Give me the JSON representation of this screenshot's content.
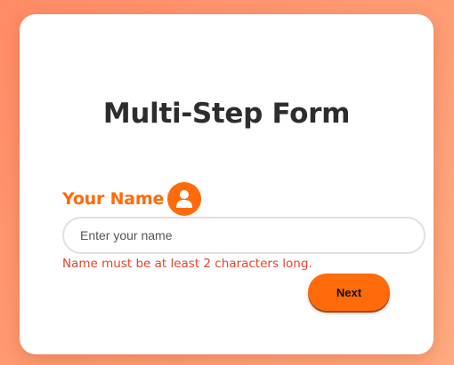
{
  "form": {
    "title": "Multi-Step Form",
    "field_label": "Your Name",
    "field_icon": "user-icon",
    "input_value": "",
    "input_placeholder": "Enter your name",
    "error_message": "Name must be at least 2 characters long.",
    "next_label": "Next"
  },
  "colors": {
    "accent": "#ff6a0a",
    "error": "#e0452a",
    "background": "#ff9b73",
    "card": "#ffffff",
    "title": "#2d2d2d"
  }
}
